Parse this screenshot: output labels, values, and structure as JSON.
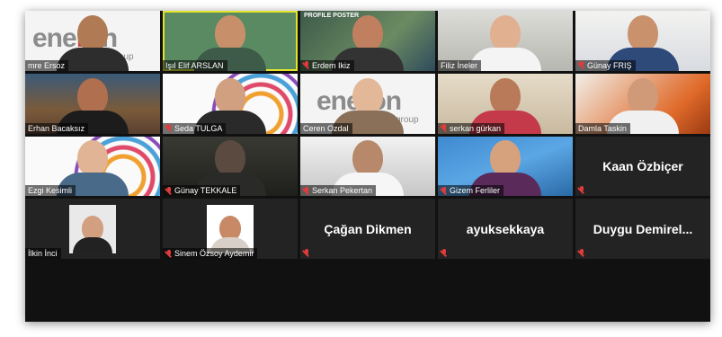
{
  "participants": [
    {
      "name": "mre Ersoz",
      "muted": false
    },
    {
      "name": "Işıl Elif ARSLAN",
      "muted": false
    },
    {
      "name": "Erdem Ikiz",
      "muted": true
    },
    {
      "name": "Filiz İneler",
      "muted": false
    },
    {
      "name": "Günay FRIŞ",
      "muted": true
    },
    {
      "name": "Erhan Bacaksız",
      "muted": false
    },
    {
      "name": "Seda TULGA",
      "muted": true
    },
    {
      "name": "Ceren Ozdal",
      "muted": false
    },
    {
      "name": "serkan gürkan",
      "muted": true
    },
    {
      "name": "Damla Taskin",
      "muted": false
    },
    {
      "name": "Ezgi Kesimli",
      "muted": false
    },
    {
      "name": "Günay TEKKALE",
      "muted": true
    },
    {
      "name": "Serkan Pekertan",
      "muted": true
    },
    {
      "name": "Gizem Ferliler",
      "muted": true
    },
    {
      "name": "Kaan Özbiçer",
      "muted": true
    },
    {
      "name": "İlkin İnci",
      "muted": false
    },
    {
      "name": "Sinem Özsoy Aydemir",
      "muted": true
    },
    {
      "name": "Çağan Dikmen",
      "muted": true
    },
    {
      "name": "ayuksekkaya",
      "muted": true
    },
    {
      "name": "Duygu Demirel...",
      "muted": true
    }
  ],
  "logo": {
    "text_a": "ene",
    "text_o": "o",
    "text_b": "n",
    "sub": "group",
    "left_fragment": "en"
  },
  "overlay": {
    "profile_label": "PROFILE POSTER"
  },
  "colors": {
    "active_border": "#e3e32a",
    "muted_icon": "#e23b3b",
    "tile_bg": "#232323"
  }
}
